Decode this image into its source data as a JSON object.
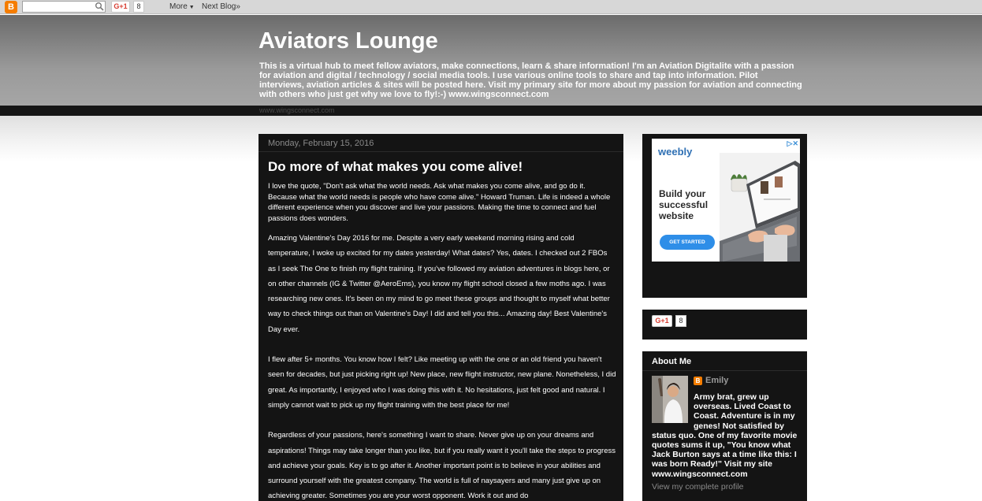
{
  "navbar": {
    "search_value": "",
    "gplus_label": "G+1",
    "gplus_count": "8",
    "more_label": "More",
    "next_blog_label": "Next Blog»"
  },
  "header": {
    "title": "Aviators Lounge",
    "description": "This is a virtual hub to meet fellow aviators, make connections, learn & share information! I'm an Aviation Digitalite with a passion for aviation and digital / technology / social media tools. I use various online tools to share and tap into information. Pilot interviews, aviation articles & sites will be posted here. Visit my primary site for more about my passion for aviation and connecting with others who just get why we love to fly!:-) www.wingsconnect.com",
    "link": "www.wingsconnect.com"
  },
  "post": {
    "date": "Monday, February 15, 2016",
    "title": "Do more of what makes you come alive!",
    "intro": "I love the quote, \"Don't ask what the world needs. Ask what makes you come alive, and go do it. Because what the world needs is people who have come alive.\" Howard Truman. Life is indeed a whole different experience when you discover and live your passions. Making the time to connect and fuel passions does wonders.",
    "para1": "Amazing Valentine's Day 2016 for me. Despite a very early weekend morning rising and cold temperature, I woke up excited for my dates yesterday!  What dates? Yes, dates. I checked out 2 FBOs as I seek The One to finish my flight training. If you've followed my aviation adventures in blogs here, or on other channels (IG & Twitter @AeroEms), you know my flight school closed a few moths ago.  I was researching new ones. It's been on my mind to go meet these groups and thought to myself what better way to check things out than on Valentine's Day! I did and tell you this... Amazing day! Best Valentine's Day ever.",
    "para2": "I flew after 5+ months. You know how I felt? Like meeting up with the one or an old friend you haven't seen for decades, but just picking right up! New place, new flight instructor, new plane. Nonetheless, I did great. As importantly, I enjoyed who I was doing this with it. No hesitations, just felt good and natural. I simply cannot wait to pick up my flight training with the best place for me!",
    "para3": "Regardless of your passions, here's something I want to share. Never give up on your dreams and aspirations! Things may take longer than you like, but if you really want it you'll take the steps to progress and achieve your goals. Key is to go after it. Another important point is to believe in your abilities and surround yourself with the greatest company. The world is full of naysayers and many just give up on achieving greater. Sometimes you are your worst opponent. Work it out and do"
  },
  "ad": {
    "brand": "weebly",
    "headline": "Build your successful website",
    "cta": "GET STARTED",
    "choices": "▷✕"
  },
  "sidebar_gplus": {
    "label": "G+1",
    "count": "8"
  },
  "about": {
    "title": "About Me",
    "name": "Emily",
    "bio": "Army brat, grew up overseas. Lived Coast to Coast. Adventure is in my genes! Not satisfied by status quo. One of my favorite movie quotes sums it up, \"You know what Jack Burton says at a time like this: I was born Ready!\" Visit my site www.wingsconnect.com",
    "bio_top": "Army brat, grew up overseas. Lived Coast to Coast. Adventure is in my genes! Not satisfied by",
    "bio_rest": "status quo. One of my favorite movie quotes sums it up, \"You know what Jack Burton says at a time like this: I was born Ready!\" Visit my site www.wingsconnect.com",
    "view_profile": "View my complete profile"
  },
  "colors": {
    "accent_orange": "#f57d00",
    "panel_bg": "#141414",
    "gplus_red": "#d73d32",
    "weebly_blue": "#2f70b4"
  }
}
